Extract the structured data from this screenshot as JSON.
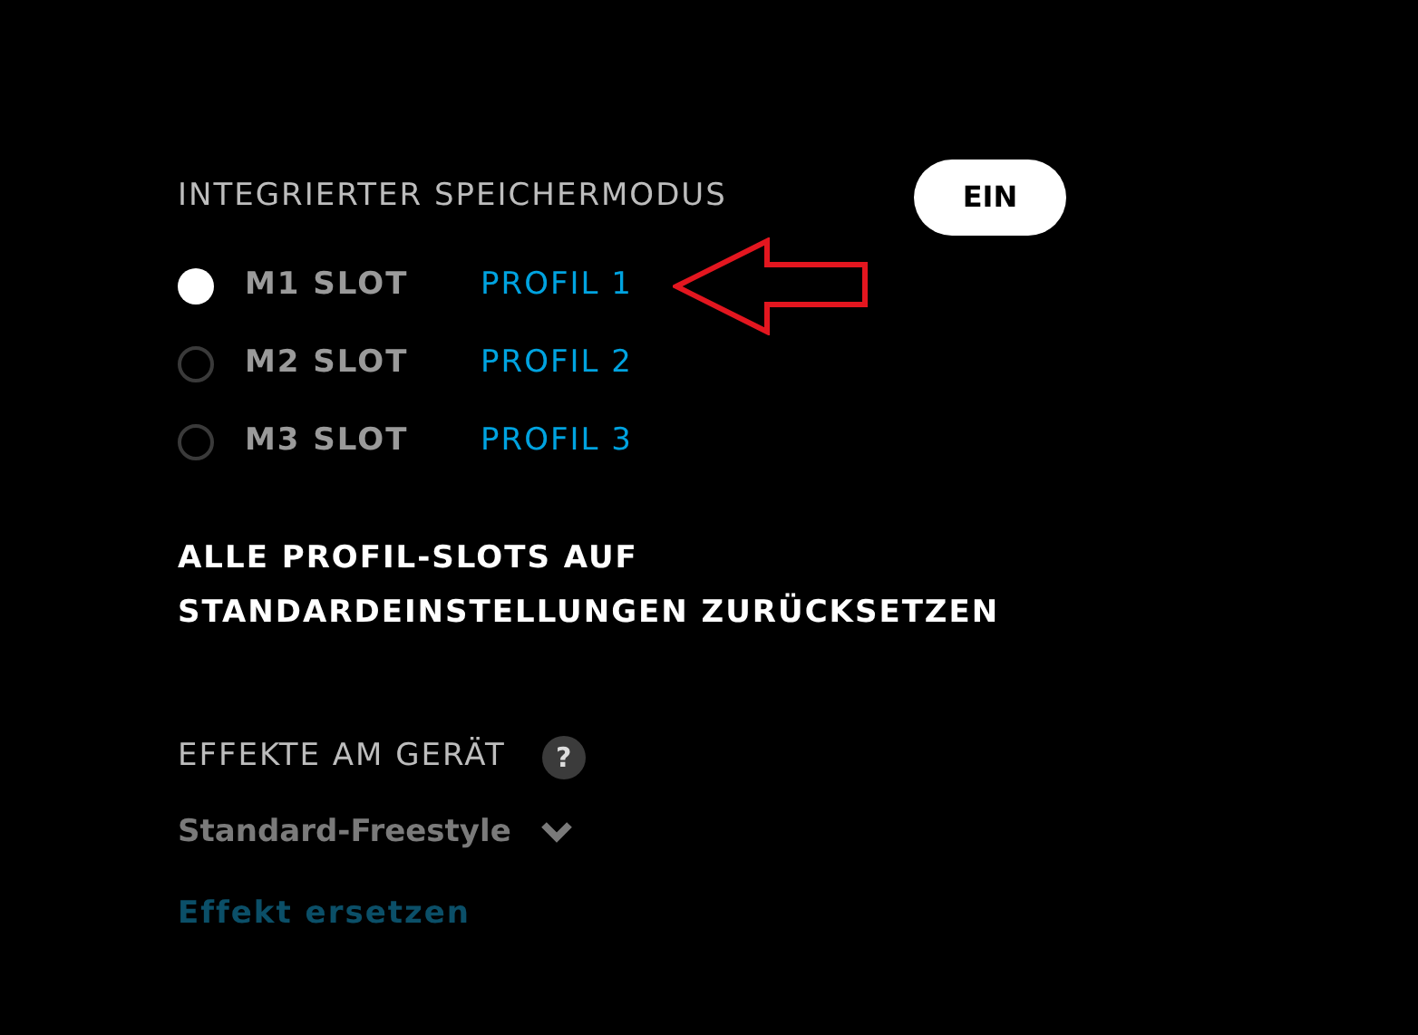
{
  "memory_mode": {
    "label": "INTEGRIERTER SPEICHERMODUS",
    "toggle": {
      "label": "EIN",
      "on": true
    }
  },
  "slots": [
    {
      "slot": "M1 SLOT",
      "profile": "PROFIL 1",
      "selected": true
    },
    {
      "slot": "M2 SLOT",
      "profile": "PROFIL 2",
      "selected": false
    },
    {
      "slot": "M3 SLOT",
      "profile": "PROFIL 3",
      "selected": false
    }
  ],
  "reset_lines": [
    "ALLE PROFIL-SLOTS AUF",
    "STANDARDEINSTELLUNGEN ZURÜCKSETZEN"
  ],
  "effects": {
    "label": "EFFEKTE AM GERÄT",
    "help": "?",
    "dropdown": "Standard-Freestyle",
    "link": "Effekt ersetzen"
  }
}
